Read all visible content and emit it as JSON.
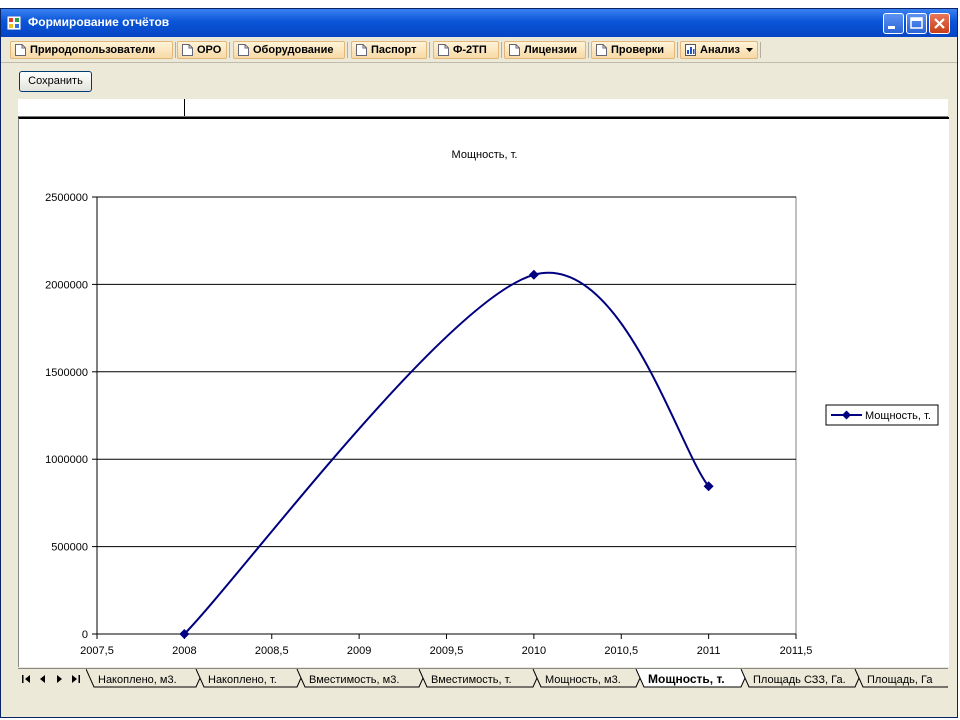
{
  "window": {
    "title": "Формирование отчётов"
  },
  "toolbar_tabs": [
    {
      "label": "Природопользователи",
      "icon": "document-icon"
    },
    {
      "label": "ОРО",
      "icon": "document-icon"
    },
    {
      "label": "Оборудование",
      "icon": "document-icon"
    },
    {
      "label": "Паспорт",
      "icon": "document-icon"
    },
    {
      "label": "Ф-2ТП",
      "icon": "document-icon"
    },
    {
      "label": "Лицензии",
      "icon": "document-icon"
    },
    {
      "label": "Проверки",
      "icon": "document-icon"
    },
    {
      "label": "Анализ",
      "icon": "bar-chart-icon",
      "has_dropdown": true
    }
  ],
  "actions": {
    "save_label": "Сохранить"
  },
  "chart_data": {
    "type": "scatter",
    "title": "Мощность, т.",
    "xlabel": "",
    "ylabel": "",
    "xlim": [
      2007.5,
      2011.5
    ],
    "ylim": [
      0,
      2500000
    ],
    "x_ticks": [
      "2007,5",
      "2008",
      "2008,5",
      "2009",
      "2009,5",
      "2010",
      "2010,5",
      "2011",
      "2011,5"
    ],
    "y_ticks": [
      "0",
      "500000",
      "1000000",
      "1500000",
      "2000000",
      "2500000"
    ],
    "y_tick_values": [
      0,
      500000,
      1000000,
      1500000,
      2000000,
      2500000
    ],
    "x_tick_values": [
      2007.5,
      2008,
      2008.5,
      2009,
      2009.5,
      2010,
      2010.5,
      2011,
      2011.5
    ],
    "grid": "horizontal",
    "smooth": true,
    "legend": "right",
    "series": [
      {
        "name": "Мощность, т.",
        "x": [
          2008,
          2010,
          2011
        ],
        "y": [
          0,
          2055000,
          845000
        ],
        "color": "#000080",
        "marker": "diamond"
      }
    ]
  },
  "sheet_tabs": [
    {
      "label": "Накоплено, м3.",
      "active": false
    },
    {
      "label": "Накоплено, т.",
      "active": false
    },
    {
      "label": "Вместимость, м3.",
      "active": false
    },
    {
      "label": "Вместимость, т.",
      "active": false
    },
    {
      "label": "Мощность, м3.",
      "active": false
    },
    {
      "label": "Мощность, т.",
      "active": true
    },
    {
      "label": "Площадь СЗЗ, Га.",
      "active": false
    },
    {
      "label": "Площадь, Га",
      "active": false
    }
  ],
  "colors": {
    "title_bar": "#0a55d8",
    "tab_bg": "#f7d9a5",
    "series": "#000080"
  }
}
